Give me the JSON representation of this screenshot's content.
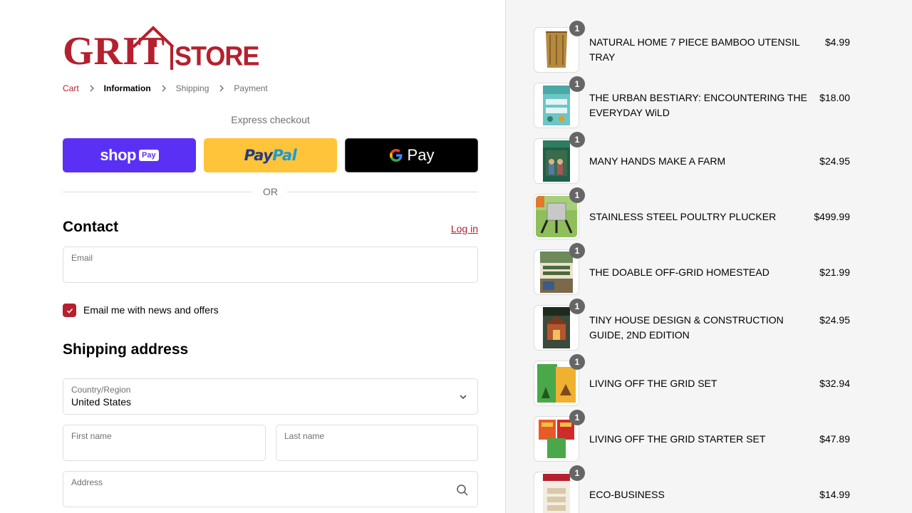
{
  "brand": {
    "logo_text_1": "GRIT",
    "logo_text_2": "STORE",
    "accent": "#b5202e"
  },
  "breadcrumb": [
    {
      "label": "Cart",
      "state": "link"
    },
    {
      "label": "Information",
      "state": "current"
    },
    {
      "label": "Shipping",
      "state": "upcoming"
    },
    {
      "label": "Payment",
      "state": "upcoming"
    }
  ],
  "express": {
    "title": "Express checkout",
    "shop_label": "shop",
    "shop_badge": "Pay",
    "paypal_1": "Pay",
    "paypal_2": "Pal",
    "gpay_label": "Pay",
    "or": "OR"
  },
  "contact": {
    "heading": "Contact",
    "login": "Log in",
    "email_label": "Email",
    "email_value": "",
    "newsletter_label": "Email me with news and offers",
    "newsletter_checked": true
  },
  "shipping": {
    "heading": "Shipping address",
    "country_label": "Country/Region",
    "country_value": "United States",
    "first_name_label": "First name",
    "last_name_label": "Last name",
    "address_label": "Address"
  },
  "cart": {
    "items": [
      {
        "name": "NATURAL HOME 7 PIECE BAMBOO UTENSIL TRAY",
        "price": "$4.99",
        "qty": "1"
      },
      {
        "name": "THE URBAN BESTIARY: ENCOUNTERING THE EVERYDAY WiLD",
        "price": "$18.00",
        "qty": "1"
      },
      {
        "name": "MANY HANDS MAKE A FARM",
        "price": "$24.95",
        "qty": "1"
      },
      {
        "name": "STAINLESS STEEL POULTRY PLUCKER",
        "price": "$499.99",
        "qty": "1"
      },
      {
        "name": "THE DOABLE OFF-GRID HOMESTEAD",
        "price": "$21.99",
        "qty": "1"
      },
      {
        "name": "TINY HOUSE DESIGN & CONSTRUCTION GUIDE, 2ND EDITION",
        "price": "$24.95",
        "qty": "1"
      },
      {
        "name": "LIVING OFF THE GRID SET",
        "price": "$32.94",
        "qty": "1"
      },
      {
        "name": "LIVING OFF THE GRID STARTER SET",
        "price": "$47.89",
        "qty": "1"
      },
      {
        "name": "ECO-BUSINESS",
        "price": "$14.99",
        "qty": "1"
      }
    ]
  }
}
